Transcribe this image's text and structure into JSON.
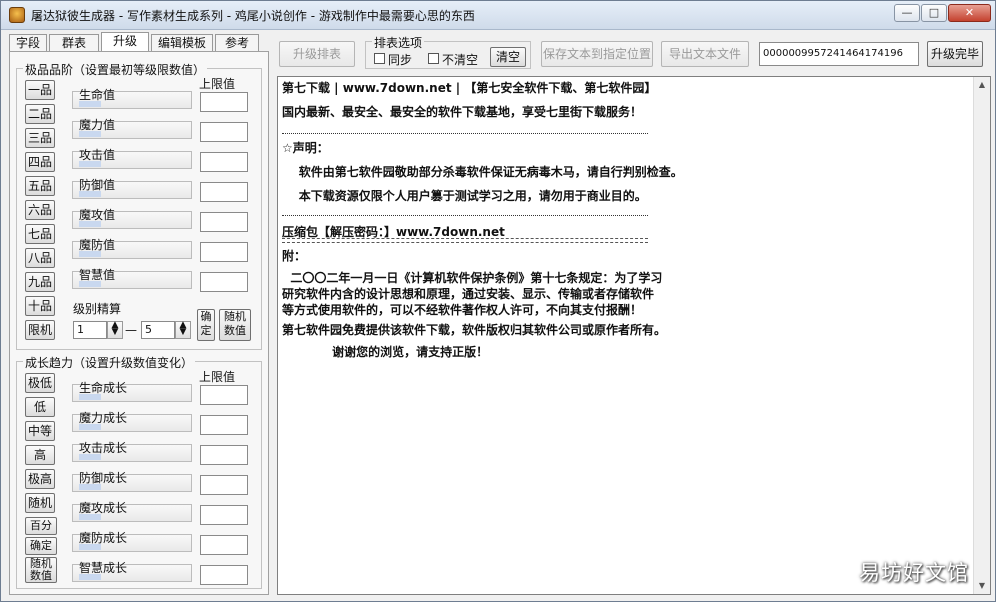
{
  "window": {
    "title": "屠达狱彼生成器 - 写作素材生成系列 - 鸡尾小说创作 - 游戏制作中最需要心思的东西",
    "min_label": "—",
    "max_label": "□",
    "close_label": "✕"
  },
  "tabs": [
    "字段",
    "群表",
    "升级",
    "编辑模板",
    "参考"
  ],
  "grade_group": {
    "legend": "极品品阶（设置最初等级限数值）",
    "grades": [
      "一品",
      "二品",
      "三品",
      "四品",
      "五品",
      "六品",
      "七品",
      "八品",
      "九品",
      "十品",
      "限机"
    ],
    "stats": [
      "生命值",
      "魔力值",
      "攻击值",
      "防御值",
      "魔攻值",
      "魔防值",
      "智慧值"
    ],
    "upper_label": "上限值",
    "level_range_label": "级别精算",
    "range_from": "1",
    "range_dash": "—",
    "range_to": "5",
    "decide_label": "确定",
    "random_label": "随机数值"
  },
  "growth_group": {
    "legend": "成长趋力（设置升级数值变化）",
    "levels": [
      "极低",
      "低",
      "中等",
      "高",
      "极高",
      "随机"
    ],
    "extra_buttons": [
      "百分",
      "确定",
      "随机数值"
    ],
    "stats": [
      "生命成长",
      "魔力成长",
      "攻击成长",
      "防御成长",
      "魔攻成长",
      "魔防成长",
      "智慧成长"
    ],
    "upper_label": "上限值"
  },
  "toolbar": {
    "upgrade_table": "升级排表",
    "filter_legend": "排表选项",
    "option1": "同步",
    "option2": "不清空",
    "clear": "清空",
    "save_text": "保存文本到指定位置",
    "export_text": "导出文本文件",
    "code_value": "0000009957241464174196",
    "upgrade_done": "升级完毕"
  },
  "document": {
    "lines": [
      "第七下载 | www.7down.net | 【第七安全软件下载、第七软件园】",
      "国内最新、最安全、最安全的软件下载基地，享受七里街下载服务！",
      "",
      "☆声明：",
      "    软件由第七软件园敬助部分杀毒软件保证无病毒木马，请自行判别检查。",
      "    本下载资源仅限个人用户篡于测试学习之用，请勿用于商业目的。",
      "",
      "压缩包【解压密码：】www.7down.net",
      "附：",
      "  二〇〇二年一月一日《计算机软件保护条例》第十七条规定：为了学习",
      "研究软件内含的设计思想和原理，通过安装、显示、传输或者存储软件",
      "等方式使用软件的，可以不经软件著作权人许可，不向其支付报酬！",
      "第七软件园免费提供该软件下载，软件版权归其软件公司或原作者所有。",
      "            谢谢您的浏览，请支持正版！"
    ]
  },
  "watermark": "易坊好文馆"
}
